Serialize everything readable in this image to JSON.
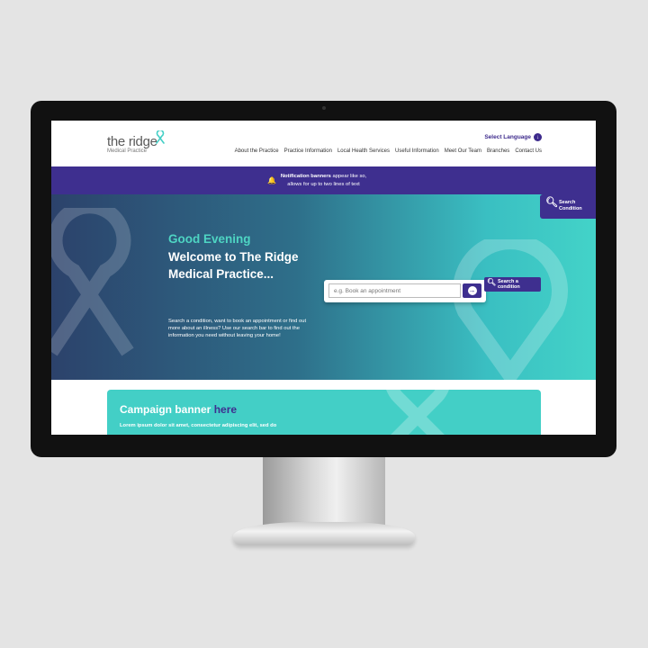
{
  "header": {
    "logo_main": "the ridge",
    "logo_sub": "Medical Practice",
    "language_label": "Select Language",
    "nav": [
      "About the Practice",
      "Practice Information",
      "Local Health Services",
      "Useful Information",
      "Meet Our Team",
      "Branches",
      "Contact Us"
    ]
  },
  "notification": {
    "bold": "Notification banners",
    "text1": " appear like so,",
    "text2": "allows for up to two lines of text"
  },
  "side_search": {
    "line1": "Search",
    "line2": "Condition"
  },
  "hero": {
    "greeting": "Good Evening",
    "welcome": "Welcome to The Ridge Medical Practice...",
    "description": "Search a condition, want to book an appointment or find out more about an illness? Use our search bar to find out the information you need without leaving your home!",
    "search_placeholder": "e.g. Book an appointment",
    "search_condition_line1": "Search a",
    "search_condition_line2": "condition"
  },
  "campaign": {
    "title": "Campaign banner ",
    "title_highlight": "here",
    "text": "Lorem ipsum dolor sit amet, consectetur adipiscing elit, sed do"
  },
  "colors": {
    "primary_purple": "#3e2f8f",
    "teal": "#43cfc6",
    "hero_dark": "#2c426b"
  }
}
